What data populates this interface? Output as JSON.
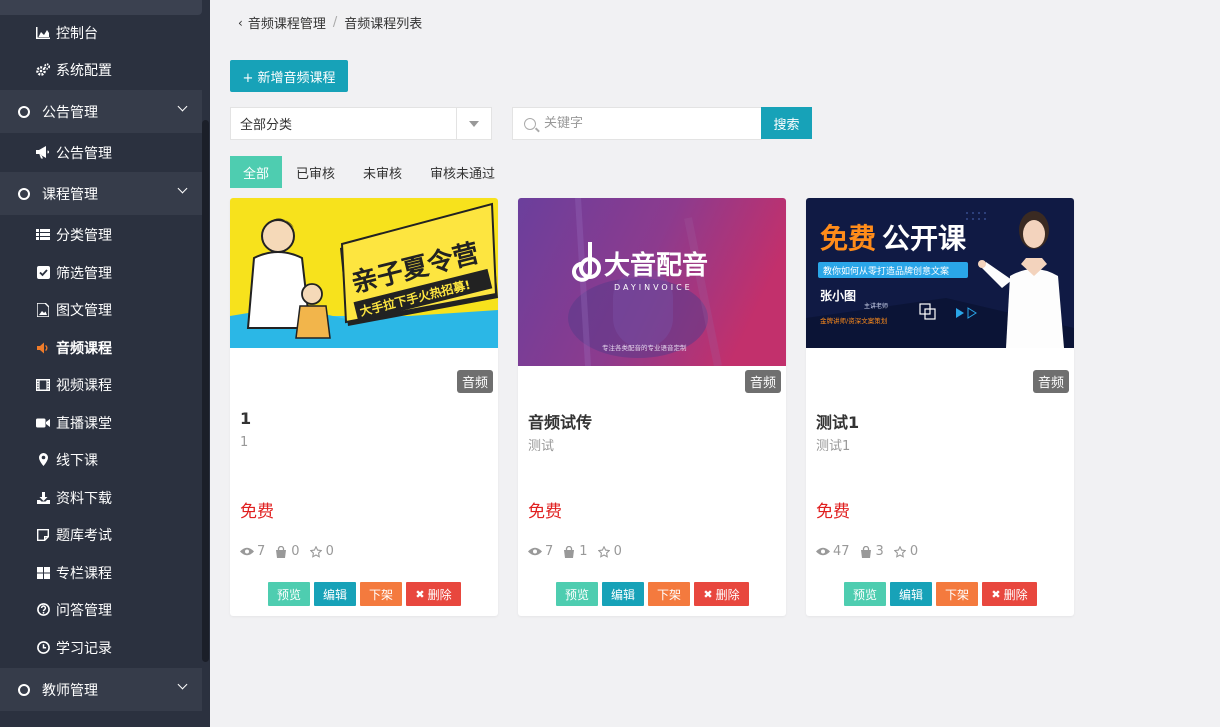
{
  "sidebar": {
    "items": [
      {
        "label": "控制台",
        "icon": "area-chart-icon"
      },
      {
        "label": "系统配置",
        "icon": "cogs-icon"
      },
      {
        "label": "公告管理",
        "icon": "ring-icon",
        "group": true
      },
      {
        "label": "公告管理",
        "icon": "bullhorn-icon"
      },
      {
        "label": "课程管理",
        "icon": "ring-icon",
        "group": true
      },
      {
        "label": "分类管理",
        "icon": "list-icon"
      },
      {
        "label": "筛选管理",
        "icon": "check-square-icon"
      },
      {
        "label": "图文管理",
        "icon": "image-file-icon"
      },
      {
        "label": "音频课程",
        "icon": "volume-icon",
        "active": true
      },
      {
        "label": "视频课程",
        "icon": "film-icon"
      },
      {
        "label": "直播课堂",
        "icon": "video-camera-icon"
      },
      {
        "label": "线下课",
        "icon": "map-marker-icon"
      },
      {
        "label": "资料下载",
        "icon": "download-icon"
      },
      {
        "label": "题库考试",
        "icon": "sticky-note-icon"
      },
      {
        "label": "专栏课程",
        "icon": "th-large-icon"
      },
      {
        "label": "问答管理",
        "icon": "question-circle-icon"
      },
      {
        "label": "学习记录",
        "icon": "clock-icon"
      },
      {
        "label": "教师管理",
        "icon": "ring-icon",
        "group": true
      }
    ]
  },
  "breadcrumb": {
    "parent": "音频课程管理",
    "separator": "/",
    "current": "音频课程列表"
  },
  "toolbar": {
    "add_label": "+ 新增音频课程"
  },
  "filter": {
    "category_selected": "全部分类",
    "search_placeholder": "关键字",
    "search_label": "搜索"
  },
  "tabs": [
    {
      "label": "全部",
      "active": true
    },
    {
      "label": "已审核"
    },
    {
      "label": "未审核"
    },
    {
      "label": "审核未通过"
    }
  ],
  "cards": [
    {
      "badge": "音频",
      "title": "1",
      "subtitle": "1",
      "price": "免费",
      "views": "7",
      "buyers": "0",
      "stars": "0",
      "thumb": {
        "heading": "亲子夏令营",
        "slogan": "大手拉下手火热招募!"
      }
    },
    {
      "badge": "音频",
      "title": "音频试传",
      "subtitle": "测试",
      "price": "免费",
      "views": "7",
      "buyers": "1",
      "stars": "0",
      "thumb": {
        "brand": "大音配音",
        "brand_en": "DAYINVOICE",
        "tagline": "专注各类配音的专业语音定制"
      }
    },
    {
      "badge": "音频",
      "title": "测试1",
      "subtitle": "测试1",
      "price": "免费",
      "views": "47",
      "buyers": "3",
      "stars": "0",
      "thumb": {
        "heading_a": "免费",
        "heading_b": "公开课",
        "ribbon": "教你如何从零打造品牌创意文案",
        "teacher": "张小图",
        "role": "主讲老师",
        "desc": "金牌讲师/资深文案策划"
      }
    }
  ],
  "actions": {
    "preview": "预览",
    "edit": "编辑",
    "off": "下架",
    "delete": "删除"
  },
  "colors": {
    "sidebar_bg": "#2b313f",
    "primary": "#17a2b8",
    "teal": "#4ecdb0",
    "orange": "#f47a3e",
    "red": "#e8473e",
    "price_red": "#e02020",
    "active_icon": "#f07c2a"
  }
}
